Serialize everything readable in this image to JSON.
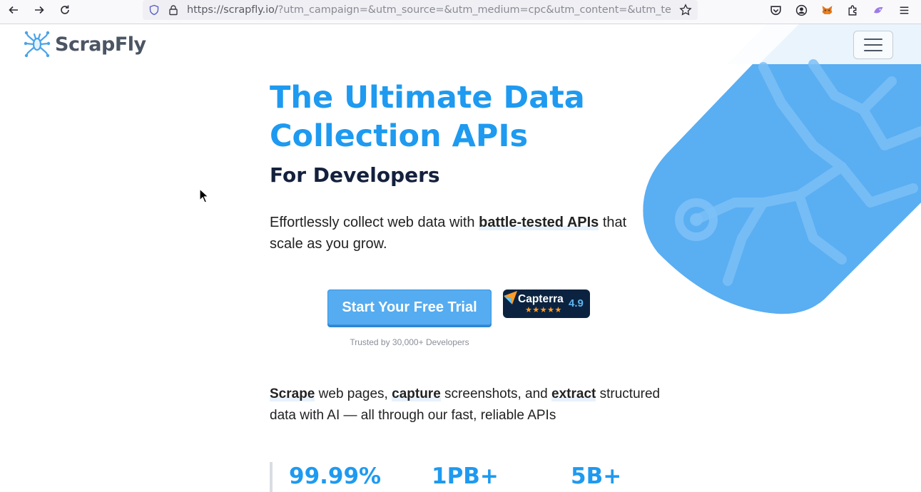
{
  "browser": {
    "url_scheme_host": "https://scrapfly.io/",
    "url_rest": "?utm_campaign=&utm_source=&utm_medium=cpc&utm_content=&utm_term=",
    "back_icon": "arrow-left-icon",
    "forward_icon": "arrow-right-icon",
    "reload_icon": "reload-icon",
    "extensions": [
      "pocket-icon",
      "account-icon",
      "metamask-icon",
      "extensions-icon",
      "custom-extension-icon",
      "menu-icon"
    ]
  },
  "header": {
    "logo_text": "ScrapFly",
    "menu_icon": "hamburger-icon"
  },
  "hero": {
    "title_line1": "The Ultimate Data",
    "title_line2": "Collection APIs",
    "subtitle": "For Developers",
    "desc_pre": "Effortlessly collect web data with ",
    "desc_bold": "battle-tested APIs",
    "desc_post": " that scale as you grow.",
    "cta_label": "Start Your Free Trial",
    "trusted_text": "Trusted by 30,000+ Developers"
  },
  "capterra": {
    "name": "Capterra",
    "stars": "★★★★★",
    "score": "4.9"
  },
  "features": {
    "w1": "Scrape",
    "t1": " web pages, ",
    "w2": "capture",
    "t2": " screenshots, and ",
    "w3": "extract",
    "t3": " structured data with AI — all through our fast, reliable APIs"
  },
  "stats": [
    {
      "value": "99.99%"
    },
    {
      "value": "1PB+"
    },
    {
      "value": "5B+"
    }
  ],
  "colors": {
    "accent": "#1e9af0",
    "cta": "#55acf0",
    "navy": "#14213d"
  }
}
